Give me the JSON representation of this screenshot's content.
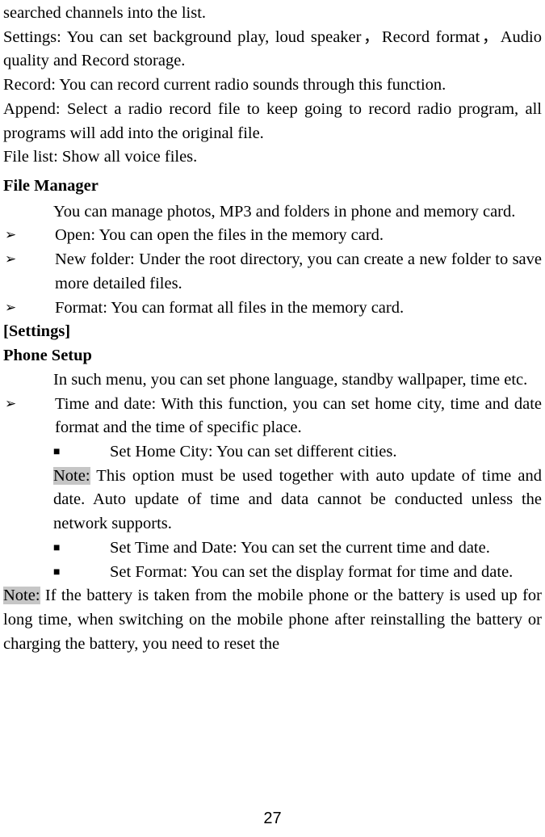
{
  "intro": {
    "p1": "searched channels into the list.",
    "p2": "Settings: You can set background play, loud speaker，Record format，Audio quality and Record storage.",
    "p3": "Record: You can record current radio sounds through this function.",
    "p4": "Append: Select a radio record file to keep going to record radio program, all programs will add into the original file.",
    "p5": "File list: Show all voice files."
  },
  "fileManager": {
    "title": "File Manager",
    "intro": "You can manage photos, MP3 and folders in phone and memory card.",
    "items": [
      "Open: You can open the files in the memory card.",
      "New folder: Under the root directory, you can create a new folder to save more detailed files.",
      "Format: You can format all files in the memory card."
    ]
  },
  "settings": {
    "heading": "[Settings]",
    "phoneSetupTitle": "Phone Setup",
    "phoneSetupIntro": "In such menu, you can set phone language, standby wallpaper, time etc.",
    "timeDate": {
      "main": "Time and date: With this function, you can set home city, time and date format and the time of specific place.",
      "sub1": "Set Home City: You can set different cities.",
      "noteLabel": "Note:",
      "noteText": " This option must be used together with auto update of time and date. Auto update of time and data cannot be conducted unless the network supports.",
      "sub2": "Set Time and Date: You can set the current time and date.",
      "sub3": "Set Format: You can set the display format for time and date."
    },
    "batteryNoteLabel": "Note:",
    "batteryNoteText": " If the battery is taken from the mobile phone or the battery is used up for long time, when switching on the mobile phone after reinstalling the battery or charging the battery, you need to reset the"
  },
  "pageNumber": "27"
}
